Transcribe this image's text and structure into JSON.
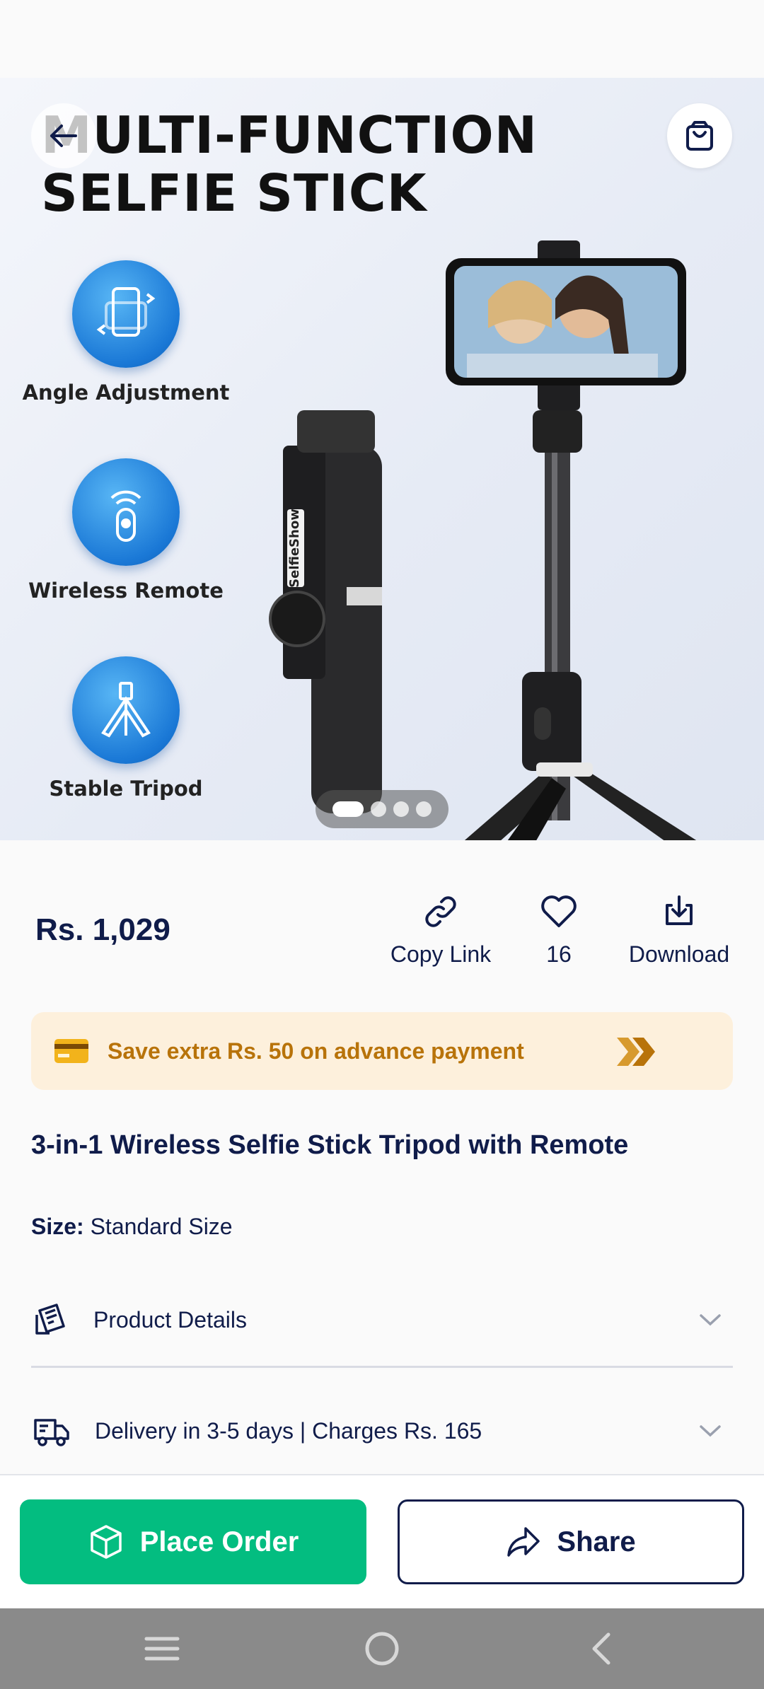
{
  "hero": {
    "title_line1": "MULTI-FUNCTION",
    "title_line2": "SELFIE STICK",
    "features": [
      {
        "label": "Angle Adjustment"
      },
      {
        "label": "Wireless Remote"
      },
      {
        "label": "Stable Tripod"
      }
    ],
    "phone_brand": "SelfieShow",
    "carousel": {
      "count": 4,
      "active_index": 0
    }
  },
  "product": {
    "price": "Rs. 1,029",
    "actions": {
      "copy_link": "Copy Link",
      "likes": "16",
      "download": "Download"
    },
    "promo": "Save extra Rs. 50 on advance payment",
    "title": "3-in-1 Wireless Selfie Stick Tripod with Remote",
    "size_label": "Size:",
    "size_value": "Standard Size",
    "details_label": "Product Details",
    "delivery_label": "Delivery in 3-5 days | Charges Rs. 165"
  },
  "bottom": {
    "order_label": "Place Order",
    "share_label": "Share"
  },
  "colors": {
    "primary_text": "#101c4a",
    "order_green": "#03bd80",
    "promo_bg": "#fdf0dc",
    "promo_text": "#b8730a"
  }
}
